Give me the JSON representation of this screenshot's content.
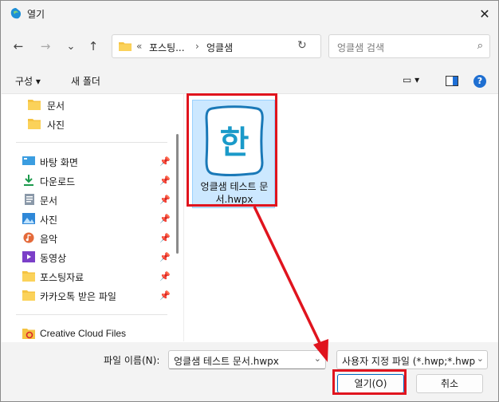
{
  "window": {
    "title": "열기",
    "close_glyph": "✕"
  },
  "nav": {
    "back": "←",
    "forward": "→",
    "dropdown": "⌄",
    "up": "↑",
    "path_overflow": "«",
    "path_folder": "포스팅...",
    "path_sep": "›",
    "path_current": "엉클샘",
    "refresh": "↻",
    "search_placeholder": "엉클샘 검색",
    "search_glyph": "⌕"
  },
  "toolbar": {
    "organize": "구성 ▾",
    "new_folder": "새 폴더",
    "view_glyph": "▭ ▾",
    "help_glyph": "?"
  },
  "sidebar": {
    "items": [
      {
        "label": "문서",
        "icon": "folder-icon"
      },
      {
        "label": "사진",
        "icon": "folder-icon"
      },
      {
        "label": "바탕 화면",
        "icon": "desktop-icon",
        "pinned": "📌"
      },
      {
        "label": "다운로드",
        "icon": "download-icon",
        "pinned": "📌"
      },
      {
        "label": "문서",
        "icon": "document-icon",
        "pinned": "📌"
      },
      {
        "label": "사진",
        "icon": "picture-icon",
        "pinned": "📌"
      },
      {
        "label": "음악",
        "icon": "music-icon",
        "pinned": "📌"
      },
      {
        "label": "동영상",
        "icon": "video-icon",
        "pinned": "📌"
      },
      {
        "label": "포스팅자료",
        "icon": "folder-icon",
        "pinned": "📌"
      },
      {
        "label": "카카오톡 받은 파일",
        "icon": "folder-icon",
        "pinned": "📌"
      },
      {
        "label": "Creative Cloud Files",
        "icon": "creative-cloud-icon"
      }
    ]
  },
  "file": {
    "name_line1": "엉클샘 테스트 문",
    "name_line2": "서.hwpx",
    "icon_glyph": "한"
  },
  "bottom": {
    "filename_label": "파일 이름(N):",
    "filename_value": "엉클샘 테스트 문서.hwpx",
    "filter_value": "사용자 지정 파일 (*.hwp;*.hwp",
    "open_label": "열기(O)",
    "cancel_label": "취소"
  },
  "colors": {
    "highlight": "#e0141e",
    "folder": "#f5c342",
    "accent": "#0067c0",
    "file_selected": "#cce8ff"
  }
}
